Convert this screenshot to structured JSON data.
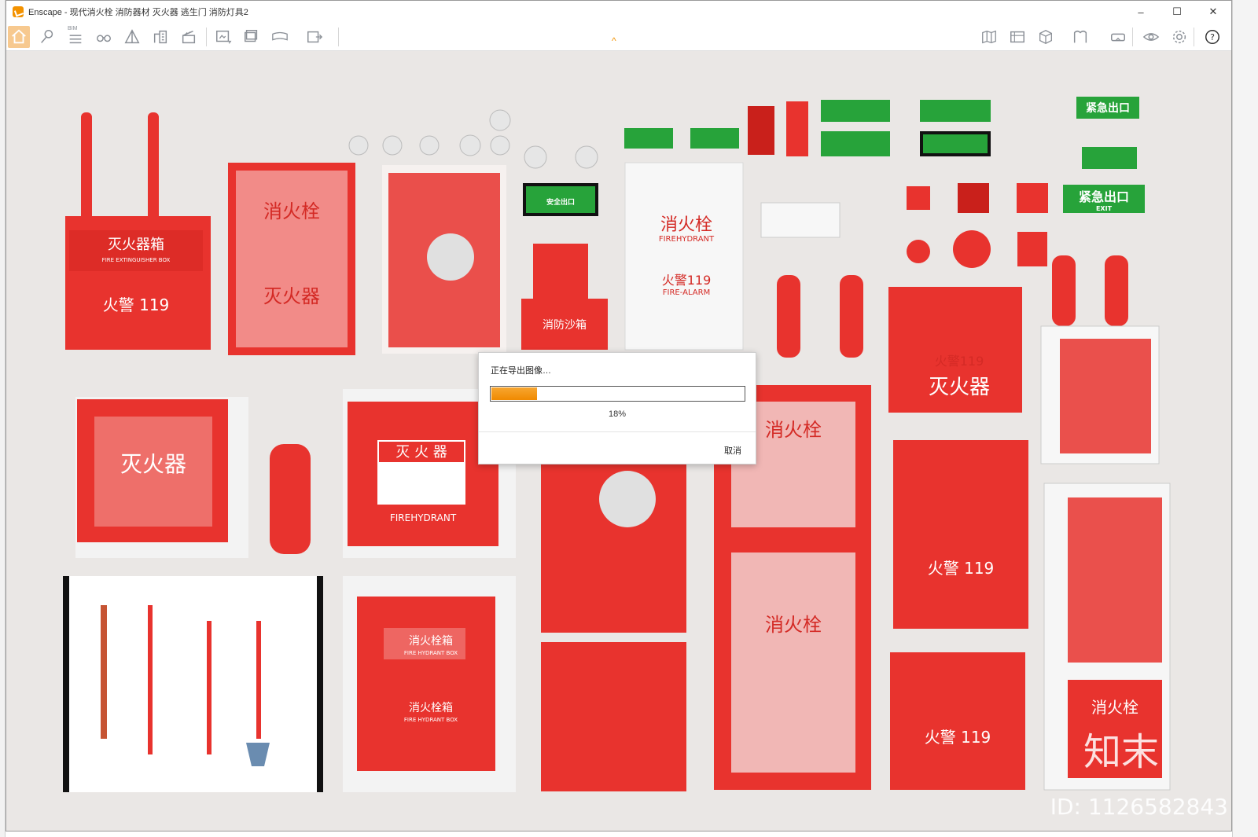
{
  "window": {
    "title": "Enscape - 现代消火栓 消防器材 灭火器 逃生门 消防灯具2",
    "controls": [
      "–",
      "☐",
      "✕"
    ]
  },
  "toolbar": {
    "bim_label": "BIM",
    "left_icons": [
      "home-icon",
      "location-pin-icon",
      "bim-list-icon",
      "binoculars-icon",
      "perspective-icon",
      "buildings-icon",
      "clapper-icon",
      "screenshot-export-icon",
      "batch-export-icon",
      "panorama-360-icon",
      "exe-export-icon"
    ],
    "right_icons": [
      "map-icon",
      "asset-library-icon",
      "cube-view-icon",
      "materials-icon",
      "vr-headset-icon",
      "eye-visual-settings-icon",
      "gear-icon",
      "help-icon"
    ]
  },
  "dialog": {
    "title": "正在导出图像…",
    "progress": 0.18,
    "progress_text": "18%",
    "cancel_label": "取消"
  },
  "scene": {
    "labels": {
      "ext_box_cn": "灭火器箱",
      "ext_box_en": "FIRE EXTINGUISHER BOX",
      "fire_alarm": "火警  119",
      "hydrant_cn": "消火栓",
      "hydrant_en": "FIREHYDRANT",
      "alarm_119": "火警119",
      "alarm_en": "FIRE-ALARM",
      "extinguisher": "灭火器",
      "sand_box": "消防沙箱",
      "box_cn": "消火栓箱",
      "box_en": "FIRE HYDRANT BOX",
      "emergency_exit": "紧急出口",
      "exit_en": "EXIT",
      "safe_exit": "安全出口",
      "alarm_119_box": "火警119",
      "ext_sign_cn": "灭 火 器",
      "firehydrant_sign": "FIREHYDRANT"
    },
    "watermark_brand": "知末",
    "watermark_id": "ID: 1126582843"
  }
}
